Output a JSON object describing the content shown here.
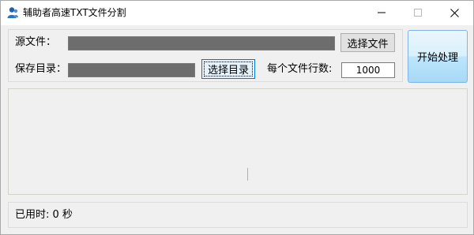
{
  "window": {
    "title": "辅助者高速TXT文件分割",
    "icons": {
      "app": "app-person-icon",
      "minimize": "minimize-icon",
      "maximize": "maximize-icon",
      "close": "close-icon"
    }
  },
  "source": {
    "label": "源文件：",
    "value": "",
    "button": "选择文件"
  },
  "output": {
    "label": "保存目录：",
    "value": "",
    "button": "选择目录"
  },
  "lines_per_file": {
    "label": "每个文件行数:",
    "value": "1000"
  },
  "start_button": "开始处理",
  "log": {
    "content": ""
  },
  "status": {
    "text": "已用时: 0 秒"
  },
  "colors": {
    "path_box": "#6d6d6d",
    "focus_border": "#0078d7",
    "start_button_blue": "#bee6fd"
  }
}
